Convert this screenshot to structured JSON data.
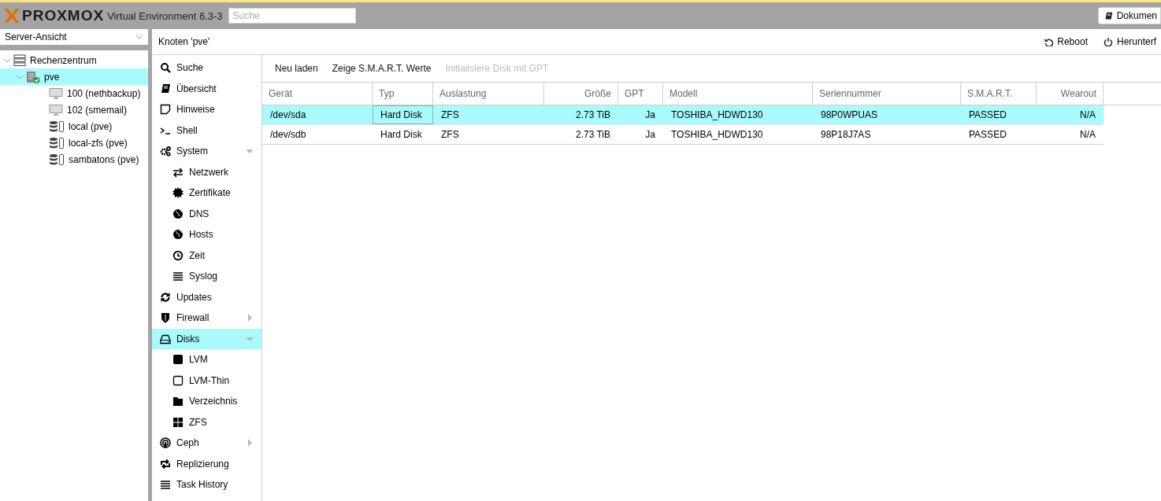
{
  "header": {
    "logo": "PROXMOX",
    "version": "Virtual Environment 6.3-3",
    "search": {
      "placeholder": "Suche"
    },
    "docs_button": "Dokumen"
  },
  "sidebar": {
    "view_select": "Server-Ansicht",
    "tree": [
      {
        "label": "Rechenzentrum",
        "kind": "datacenter",
        "expanded": true,
        "selected": false,
        "children": [
          {
            "label": "pve",
            "kind": "node",
            "expanded": true,
            "selected": true,
            "children": [
              {
                "label": "100 (nethbackup)",
                "kind": "vm",
                "selected": false
              },
              {
                "label": "102 (smemail)",
                "kind": "vm",
                "selected": false
              },
              {
                "label": "local (pve)",
                "kind": "storage",
                "selected": false
              },
              {
                "label": "local-zfs (pve)",
                "kind": "storage",
                "selected": false
              },
              {
                "label": "sambatons (pve)",
                "kind": "storage",
                "selected": false
              }
            ]
          }
        ]
      }
    ]
  },
  "panel": {
    "title": "Knoten 'pve'",
    "actions": [
      {
        "label": "Reboot",
        "kind": "reboot"
      },
      {
        "label": "Herunterf",
        "kind": "shutdown"
      }
    ]
  },
  "nav": [
    {
      "label": "Suche",
      "selected": false
    },
    {
      "label": "Übersicht",
      "selected": false
    },
    {
      "label": "Hinweise",
      "selected": false
    },
    {
      "label": "Shell",
      "selected": false
    },
    {
      "label": "System",
      "selected": false,
      "expanded": true,
      "children": [
        {
          "label": "Netzwerk",
          "selected": false
        },
        {
          "label": "Zertifikate",
          "selected": false
        },
        {
          "label": "DNS",
          "selected": false
        },
        {
          "label": "Hosts",
          "selected": false
        },
        {
          "label": "Zeit",
          "selected": false
        },
        {
          "label": "Syslog",
          "selected": false
        }
      ]
    },
    {
      "label": "Updates",
      "selected": false
    },
    {
      "label": "Firewall",
      "selected": false,
      "expanded": false
    },
    {
      "label": "Disks",
      "selected": true,
      "expanded": true,
      "children": [
        {
          "label": "LVM",
          "selected": false
        },
        {
          "label": "LVM-Thin",
          "selected": false
        },
        {
          "label": "Verzeichnis",
          "selected": false
        },
        {
          "label": "ZFS",
          "selected": false
        }
      ]
    },
    {
      "label": "Ceph",
      "selected": false,
      "expanded": false
    },
    {
      "label": "Replizierung",
      "selected": false
    },
    {
      "label": "Task History",
      "selected": false
    }
  ],
  "toolbar": [
    {
      "label": "Neu laden",
      "disabled": false
    },
    {
      "label": "Zeige S.M.A.R.T. Werte",
      "disabled": false
    },
    {
      "label": "Initialisiere Disk mit GPT",
      "disabled": true
    }
  ],
  "table": {
    "columns": [
      "Gerät",
      "Typ",
      "Auslastung",
      "Größe",
      "GPT",
      "Modell",
      "Seriennummer",
      "S.M.A.R.T.",
      "Wearout"
    ],
    "rows": [
      {
        "selected": true,
        "cells": [
          "/dev/sda",
          "Hard Disk",
          "ZFS",
          "2.73 TiB",
          "Ja",
          "TOSHIBA_HDWD130",
          "98P0WPUAS",
          "PASSED",
          "N/A"
        ]
      },
      {
        "selected": false,
        "cells": [
          "/dev/sdb",
          "Hard Disk",
          "ZFS",
          "2.73 TiB",
          "Ja",
          "TOSHIBA_HDWD130",
          "98P18J7AS",
          "PASSED",
          "N/A"
        ]
      }
    ]
  }
}
